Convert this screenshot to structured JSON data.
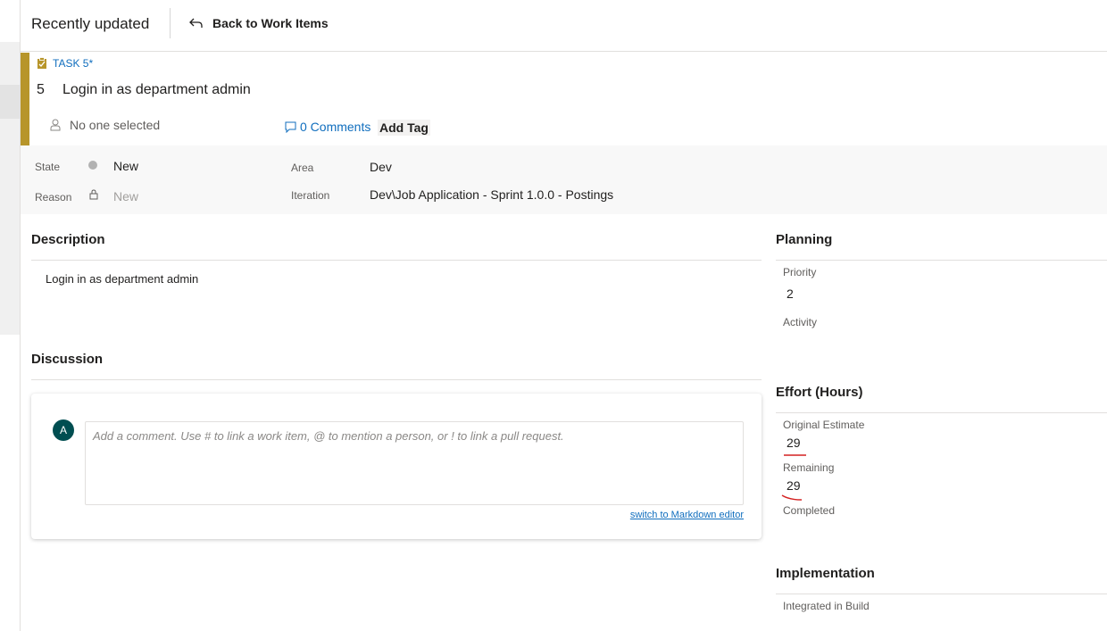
{
  "topbar": {
    "title": "Recently updated",
    "back_label": "Back to Work Items"
  },
  "work_item": {
    "type_label": "TASK 5*",
    "id": "5",
    "title": "Login in as department admin",
    "assignee": "No one selected",
    "comments_label": "0 Comments",
    "add_tag_label": "Add Tag",
    "accent_color": "#b7952a"
  },
  "fields": {
    "state_label": "State",
    "state_value": "New",
    "reason_label": "Reason",
    "reason_value": "New",
    "area_label": "Area",
    "area_value": "Dev",
    "iteration_label": "Iteration",
    "iteration_value": "Dev\\Job Application - Sprint 1.0.0 - Postings"
  },
  "description": {
    "heading": "Description",
    "text": "Login in as department admin"
  },
  "discussion": {
    "heading": "Discussion",
    "avatar_initial": "A",
    "placeholder": "Add a comment. Use # to link a work item, @ to mention a person, or ! to link a pull request.",
    "markdown_link": "switch to Markdown editor"
  },
  "planning": {
    "heading": "Planning",
    "priority_label": "Priority",
    "priority_value": "2",
    "activity_label": "Activity"
  },
  "effort": {
    "heading": "Effort (Hours)",
    "original_label": "Original Estimate",
    "original_value": "29",
    "remaining_label": "Remaining",
    "remaining_value": "29",
    "completed_label": "Completed"
  },
  "implementation": {
    "heading": "Implementation",
    "integrated_label": "Integrated in Build"
  }
}
